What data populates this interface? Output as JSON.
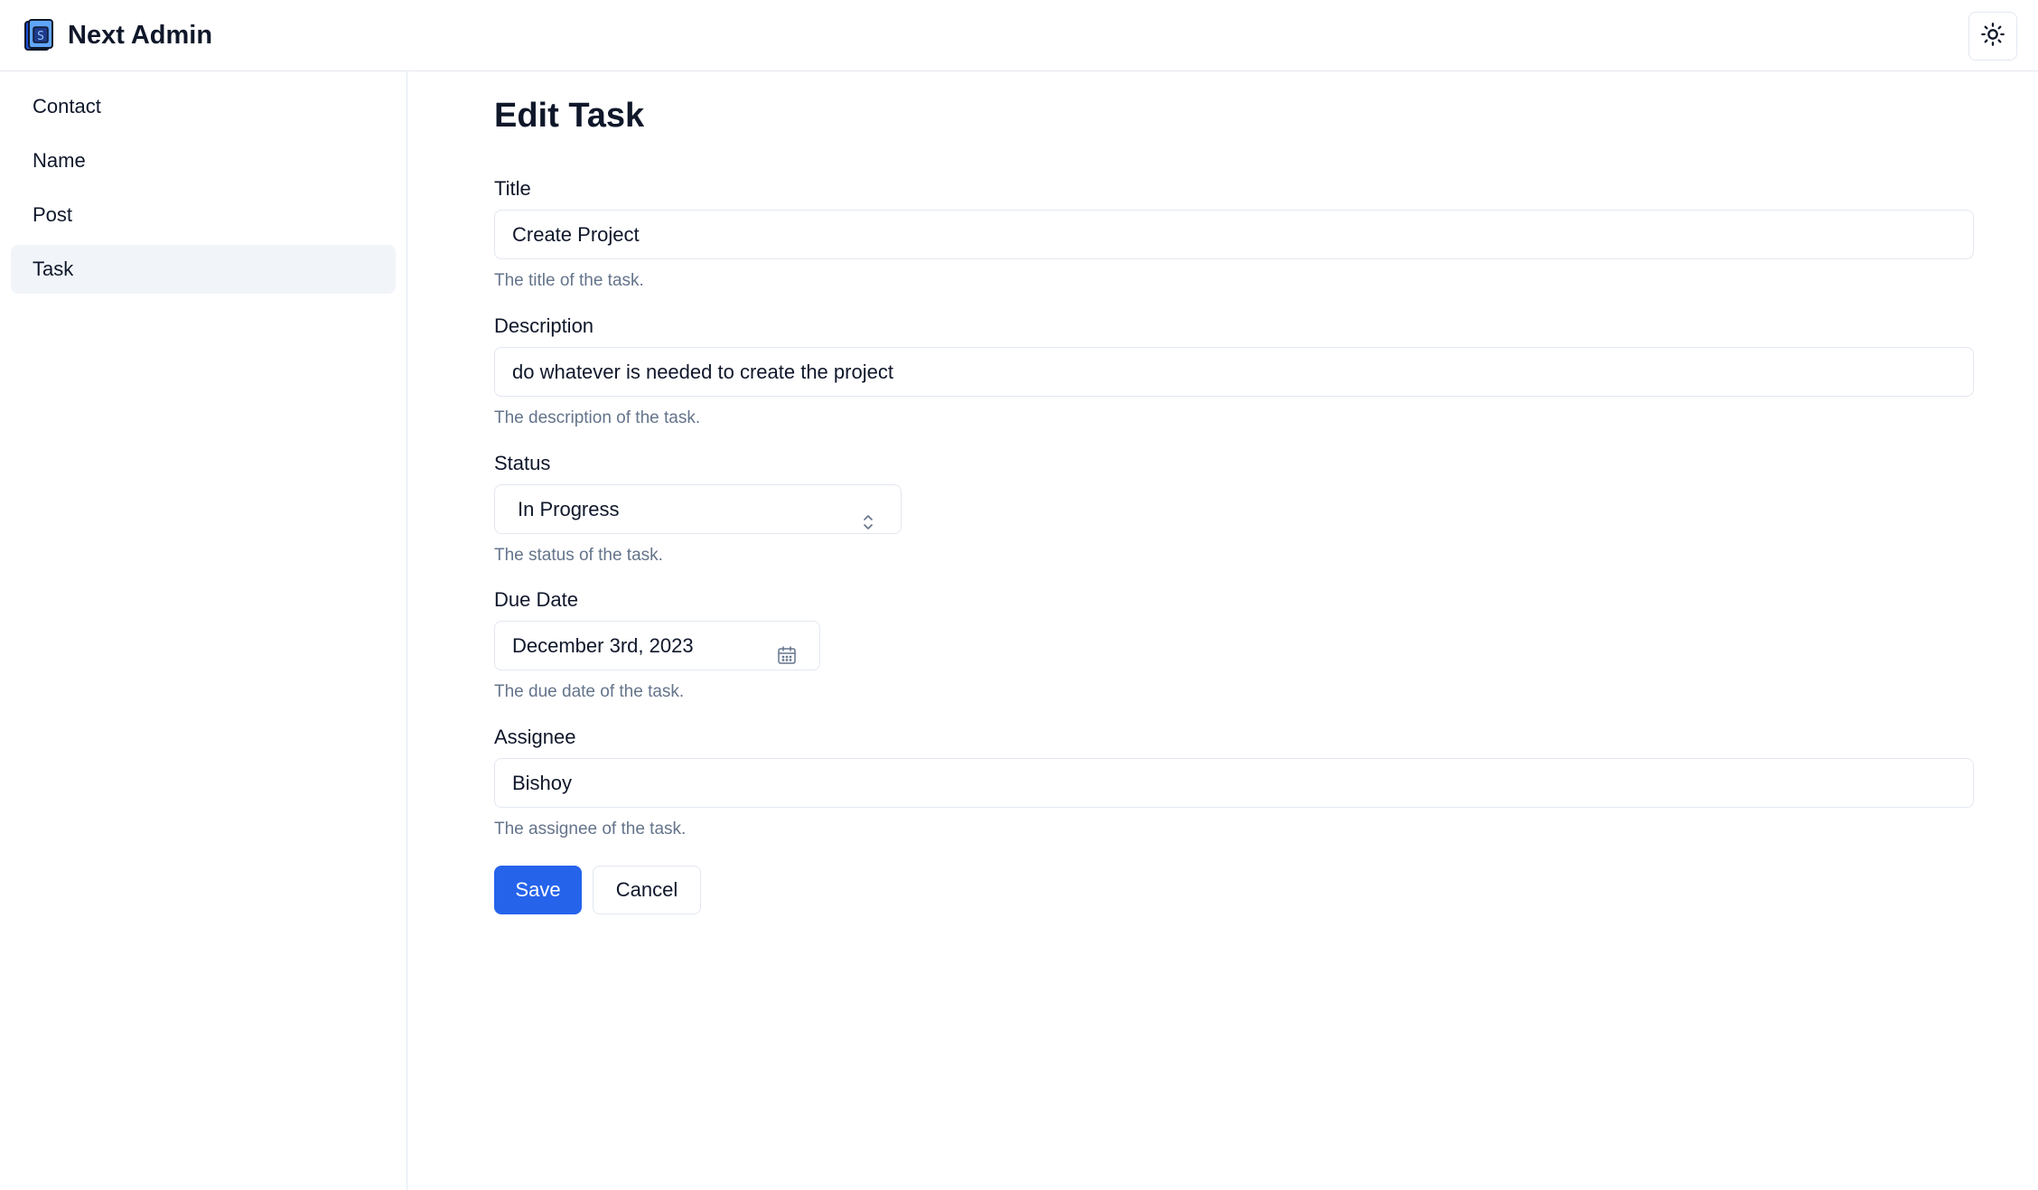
{
  "header": {
    "app_title": "Next Admin",
    "logo_icon": "database-book-icon",
    "theme_toggle_icon": "sun-icon"
  },
  "sidebar": {
    "items": [
      {
        "label": "Contact",
        "active": false
      },
      {
        "label": "Name",
        "active": false
      },
      {
        "label": "Post",
        "active": false
      },
      {
        "label": "Task",
        "active": true
      }
    ]
  },
  "form": {
    "page_title": "Edit Task",
    "title": {
      "label": "Title",
      "value": "Create Project",
      "hint": "The title of the task."
    },
    "description": {
      "label": "Description",
      "value": "do whatever is needed to create the project",
      "hint": "The description of the task."
    },
    "status": {
      "label": "Status",
      "value": "In Progress",
      "hint": "The status of the task."
    },
    "due_date": {
      "label": "Due Date",
      "value": "December 3rd, 2023",
      "hint": "The due date of the task."
    },
    "assignee": {
      "label": "Assignee",
      "value": "Bishoy",
      "hint": "The assignee of the task."
    },
    "save_label": "Save",
    "cancel_label": "Cancel"
  },
  "colors": {
    "primary": "#2563eb",
    "border": "#e2e8f0",
    "muted_text": "#64748b",
    "active_nav_bg": "#f1f5f9"
  }
}
